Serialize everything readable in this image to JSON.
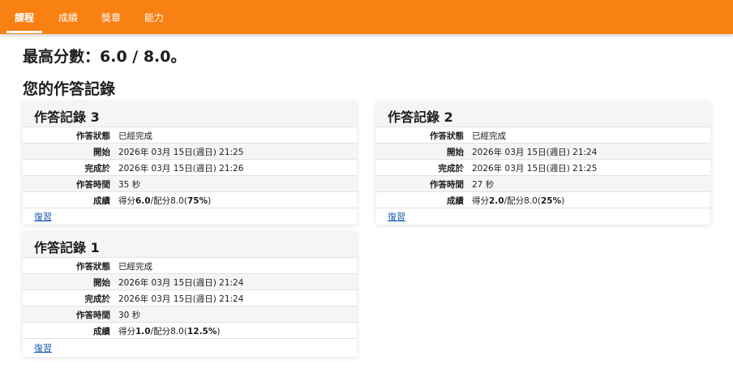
{
  "nav": {
    "tabs": [
      {
        "label": "課程",
        "active": true
      },
      {
        "label": "成績",
        "active": false
      },
      {
        "label": "獎章",
        "active": false
      },
      {
        "label": "能力",
        "active": false
      }
    ]
  },
  "summary": {
    "best_score": "最高分數：6.0 / 8.0。"
  },
  "section": {
    "title": "您的作答記錄"
  },
  "attempts": [
    {
      "title": "作答記錄 3",
      "rows": [
        {
          "label": "作答狀態",
          "value": "已經完成"
        },
        {
          "label": "開始",
          "value": "2026年 03月 15日(週日) 21:25"
        },
        {
          "label": "完成於",
          "value": "2026年 03月 15日(週日) 21:26"
        },
        {
          "label": "作答時間",
          "value": "35 秒"
        }
      ],
      "grade": {
        "label": "成績",
        "prefix": "得分",
        "score": "6.0",
        "mid": "/配分8.0(",
        "percent": "75%",
        "suffix": ")"
      },
      "review_label": "復習"
    },
    {
      "title": "作答記錄 2",
      "rows": [
        {
          "label": "作答狀態",
          "value": "已經完成"
        },
        {
          "label": "開始",
          "value": "2026年 03月 15日(週日) 21:24"
        },
        {
          "label": "完成於",
          "value": "2026年 03月 15日(週日) 21:25"
        },
        {
          "label": "作答時間",
          "value": "27 秒"
        }
      ],
      "grade": {
        "label": "成績",
        "prefix": "得分",
        "score": "2.0",
        "mid": "/配分8.0(",
        "percent": "25%",
        "suffix": ")"
      },
      "review_label": "復習"
    },
    {
      "title": "作答記錄 1",
      "rows": [
        {
          "label": "作答狀態",
          "value": "已經完成"
        },
        {
          "label": "開始",
          "value": "2026年 03月 15日(週日) 21:24"
        },
        {
          "label": "完成於",
          "value": "2026年 03月 15日(週日) 21:24"
        },
        {
          "label": "作答時間",
          "value": "30 秒"
        }
      ],
      "grade": {
        "label": "成績",
        "prefix": "得分",
        "score": "1.0",
        "mid": "/配分8.0(",
        "percent": "12.5%",
        "suffix": ")"
      },
      "review_label": "復習"
    }
  ],
  "colors": {
    "nav_bg": "#f98012",
    "link": "#1a5bb5"
  }
}
